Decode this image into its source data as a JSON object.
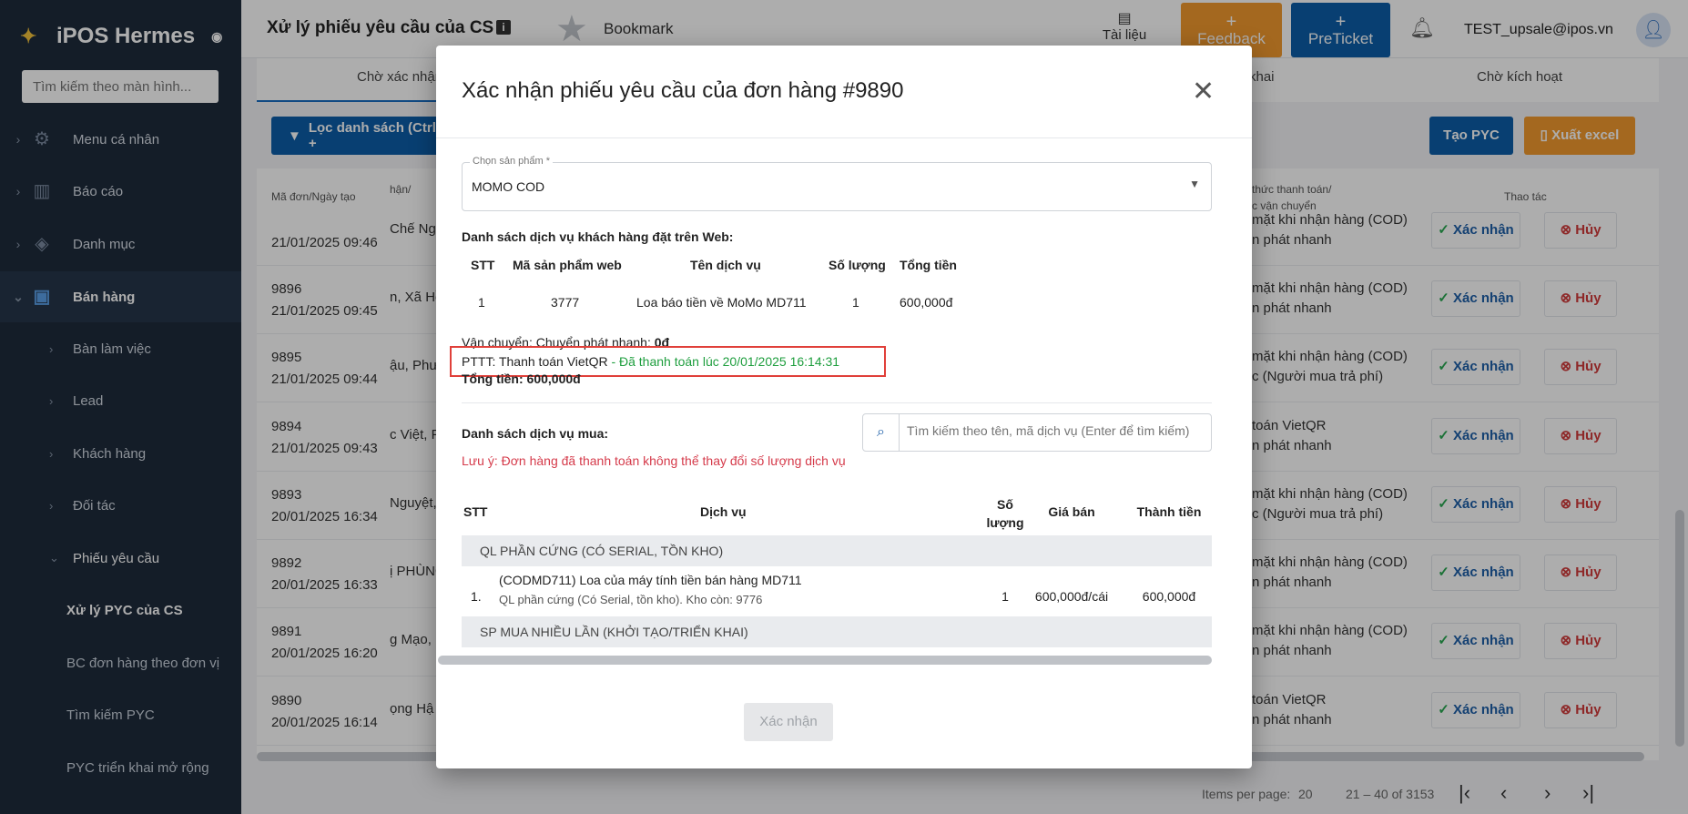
{
  "sidebar": {
    "brand": "iPOS Hermes",
    "search_placeholder": "Tìm kiếm theo màn hình...",
    "items": [
      {
        "label": "Menu cá nhân"
      },
      {
        "label": "Báo cáo"
      },
      {
        "label": "Danh mục"
      },
      {
        "label": "Bán hàng"
      }
    ],
    "sub_items": [
      {
        "label": "Bàn làm việc"
      },
      {
        "label": "Lead"
      },
      {
        "label": "Khách hàng"
      },
      {
        "label": "Đối tác"
      },
      {
        "label": "Phiếu yêu cầu"
      }
    ],
    "sub2_items": [
      {
        "label": "Xử lý PYC của CS"
      },
      {
        "label": "BC đơn hàng theo đơn vị"
      },
      {
        "label": "Tìm kiếm PYC"
      },
      {
        "label": "PYC triển khai mở rộng"
      }
    ]
  },
  "header": {
    "title": "Xử lý phiếu yêu cầu của CS",
    "bookmark": "Bookmark",
    "docs": "Tài liệu",
    "feedback": "Feedback",
    "preticket": "PreTicket",
    "user": "TEST_upsale@ipos.vn"
  },
  "main": {
    "tabs": [
      "Chờ xác nhận",
      "khai",
      "Chờ kích hoạt"
    ],
    "filter_btn": "Lọc danh sách (Ctrl +",
    "create_btn": "Tạo PYC",
    "excel_btn": "Xuất excel",
    "col_code": "Mã đơn/Ngày tạo",
    "col_name": "hận/",
    "col_pay_1": "thức thanh toán/",
    "col_pay_2": "c vận chuyển",
    "col_actions": "Thao tác",
    "confirm_label": "Xác nhận",
    "cancel_label": "Hủy",
    "rows": [
      {
        "code": "",
        "date": "21/01/2025 09:46",
        "name": "Chế Ng",
        "pay1": "mặt khi nhận hàng (COD)",
        "pay2": "n phát nhanh"
      },
      {
        "code": "9896",
        "date": "21/01/2025 09:45",
        "name": "n, Xã Hồ",
        "pay1": "mặt khi nhận hàng (COD)",
        "pay2": "n phát nhanh"
      },
      {
        "code": "9895",
        "date": "21/01/2025 09:44",
        "name": "ậu, Phươ",
        "pay1": "mặt khi nhận hàng (COD)",
        "pay2": "c (Người mua trả phí)"
      },
      {
        "code": "9894",
        "date": "21/01/2025 09:43",
        "name": "c Việt, P",
        "pay1": "toán VietQR",
        "pay2": "n phát nhanh"
      },
      {
        "code": "9893",
        "date": "20/01/2025 16:34",
        "name": "Nguyệt,",
        "pay1": "mặt khi nhận hàng (COD)",
        "pay2": "c (Người mua trả phí)"
      },
      {
        "code": "9892",
        "date": "20/01/2025 16:33",
        "name": "ị PHÙNG",
        "pay1": "mặt khi nhận hàng (COD)",
        "pay2": "n phát nhanh"
      },
      {
        "code": "9891",
        "date": "20/01/2025 16:20",
        "name": "g Mạo, P",
        "pay1": "mặt khi nhận hàng (COD)",
        "pay2": "n phát nhanh"
      },
      {
        "code": "9890",
        "date": "20/01/2025 16:14",
        "name": "ọng Hậ",
        "pay1": "toán VietQR",
        "pay2": "n phát nhanh"
      }
    ],
    "items_per_page_label": "Items per page:",
    "items_per_page": "20",
    "range": "21 – 40 of 3153"
  },
  "modal": {
    "title": "Xác nhận phiếu yêu cầu của đơn hàng #9890",
    "product_label": "Chọn sản phẩm *",
    "product_value": "MOMO COD",
    "web_list_title": "Danh sách dịch vụ khách hàng đặt trên Web:",
    "web_cols": [
      "STT",
      "Mã sản phẩm web",
      "Tên dịch vụ",
      "Số lượng",
      "Tổng tiền"
    ],
    "web_row": [
      "1",
      "3777",
      "Loa báo tiền về MoMo MD711",
      "1",
      "600,000đ"
    ],
    "shipping_label": "Vận chuyển:",
    "shipping_value": "Chuyển phát nhanh:",
    "shipping_fee": "0đ",
    "pttt_label": "PTTT: Thanh toán VietQR",
    "pttt_status": " - Đã thanh toán lúc 20/01/2025 16:14:31",
    "total_label": "Tổng tiền:",
    "total_value": "600,000đ",
    "buy_list_title": "Danh sách dịch vụ mua:",
    "search_placeholder": "Tìm kiếm theo tên, mã dịch vụ (Enter để tìm kiếm)",
    "note": "Lưu ý: Đơn hàng đã thanh toán không thể thay đổi số lượng dịch vụ",
    "svc_cols": {
      "stt": "STT",
      "service": "Dịch vụ",
      "qty_1": "Số",
      "qty_2": "lượng",
      "price": "Giá bán",
      "amount": "Thành tiền"
    },
    "group1": "QL PHẦN CỨNG (CÓ SERIAL, TỒN KHO)",
    "svc_row": {
      "stt": "1.",
      "name": "(CODMD711) Loa của máy tính tiền bán hàng MD711",
      "detail": "QL phần cứng (Có Serial, tồn kho). Kho còn: 9776",
      "qty": "1",
      "price": "600,000đ/cái",
      "amount": "600,000đ"
    },
    "group2": "SP MUA NHIỀU LẦN (KHỞI TẠO/TRIỂN KHAI)",
    "confirm": "Xác nhận"
  }
}
